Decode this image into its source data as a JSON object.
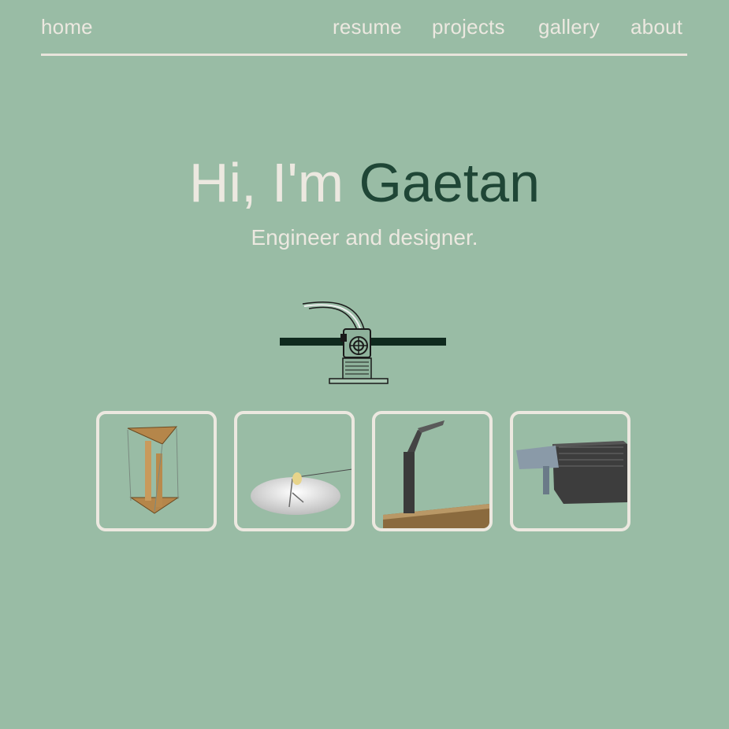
{
  "nav": {
    "home": "home",
    "resume": "resume",
    "projects": "projects",
    "gallery": "gallery",
    "about": "about"
  },
  "hero": {
    "greeting": "Hi, I'm",
    "name": "Gaetan",
    "subtitle": "Engineer and designer."
  },
  "colors": {
    "background": "#99bca5",
    "text_light": "#ece8e0",
    "accent_dark_green": "#1f4636"
  },
  "projects": [
    {
      "icon": "tensegrity-table-thumbnail"
    },
    {
      "icon": "desk-lamp-dish-thumbnail"
    },
    {
      "icon": "arm-lamp-thumbnail"
    },
    {
      "icon": "heatsink-enclosure-thumbnail"
    }
  ]
}
